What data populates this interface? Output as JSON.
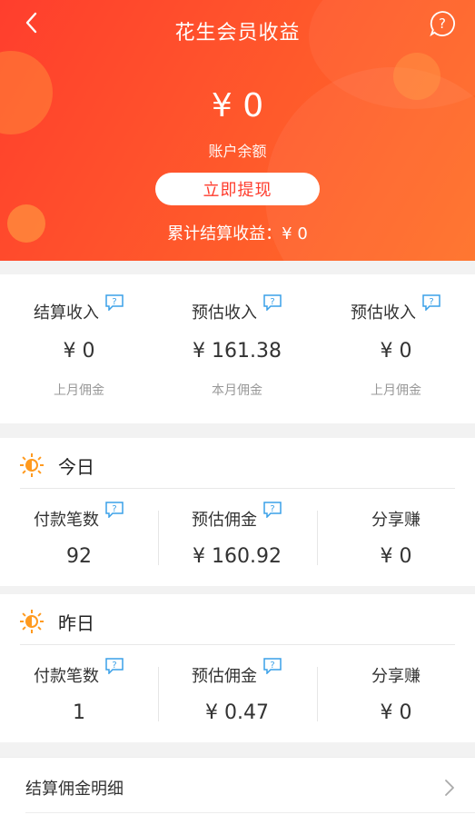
{
  "header": {
    "title": "花生会员收益",
    "balance": "¥ 0",
    "balance_label": "账户余额",
    "withdraw_label": "立即提现",
    "total_settled": "累计结算收益：¥ 0"
  },
  "summary": [
    {
      "title": "结算收入",
      "value": "¥ 0",
      "sub": "上月佣金"
    },
    {
      "title": "预估收入",
      "value": "¥ 161.38",
      "sub": "本月佣金"
    },
    {
      "title": "预估收入",
      "value": "¥ 0",
      "sub": "上月佣金"
    }
  ],
  "today": {
    "title": "今日",
    "stats": [
      {
        "label": "付款笔数",
        "value": "92"
      },
      {
        "label": "预估佣金",
        "value": "¥ 160.92"
      },
      {
        "label": "分享赚",
        "value": "¥ 0"
      }
    ]
  },
  "yesterday": {
    "title": "昨日",
    "stats": [
      {
        "label": "付款笔数",
        "value": "1"
      },
      {
        "label": "预估佣金",
        "value": "¥ 0.47"
      },
      {
        "label": "分享赚",
        "value": "¥ 0"
      }
    ]
  },
  "detail": {
    "label": "结算佣金明细"
  },
  "icons": {
    "back": "back-icon",
    "help": "help-icon",
    "info": "info-icon",
    "sun": "sun-icon",
    "chevron": "chevron-right-icon"
  },
  "colors": {
    "accent": "#ff3b2c",
    "info_blue": "#3aa0e8",
    "sun_orange": "#ff9a1f"
  }
}
